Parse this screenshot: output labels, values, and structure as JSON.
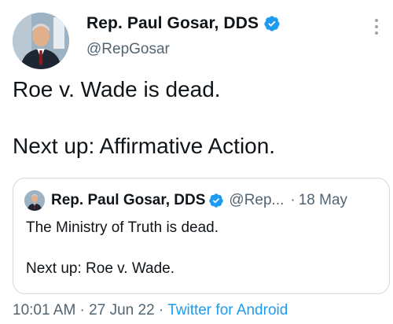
{
  "author": {
    "display_name": "Rep. Paul Gosar, DDS",
    "handle": "@RepGosar",
    "avatar_icon": "profile-photo",
    "verified_icon": "verified-badge-icon"
  },
  "tweet": {
    "line1": "Roe v. Wade is dead.",
    "line2": "Next up: Affirmative Action."
  },
  "quoted_tweet": {
    "display_name": "Rep. Paul Gosar, DDS",
    "handle": "@Rep...",
    "separator": "·",
    "date": "18 May",
    "line1": "The Ministry of Truth is dead.",
    "line2": "Next up: Roe v. Wade."
  },
  "meta": {
    "time": "10:01 AM",
    "sep1": " · ",
    "date": "27 Jun 22",
    "sep2": " · ",
    "source": "Twitter for Android"
  },
  "colors": {
    "text": "#0f1419",
    "secondary": "#536471",
    "link": "#1d9bf0",
    "verified": "#1d9bf0",
    "border": "#cfd9de"
  }
}
